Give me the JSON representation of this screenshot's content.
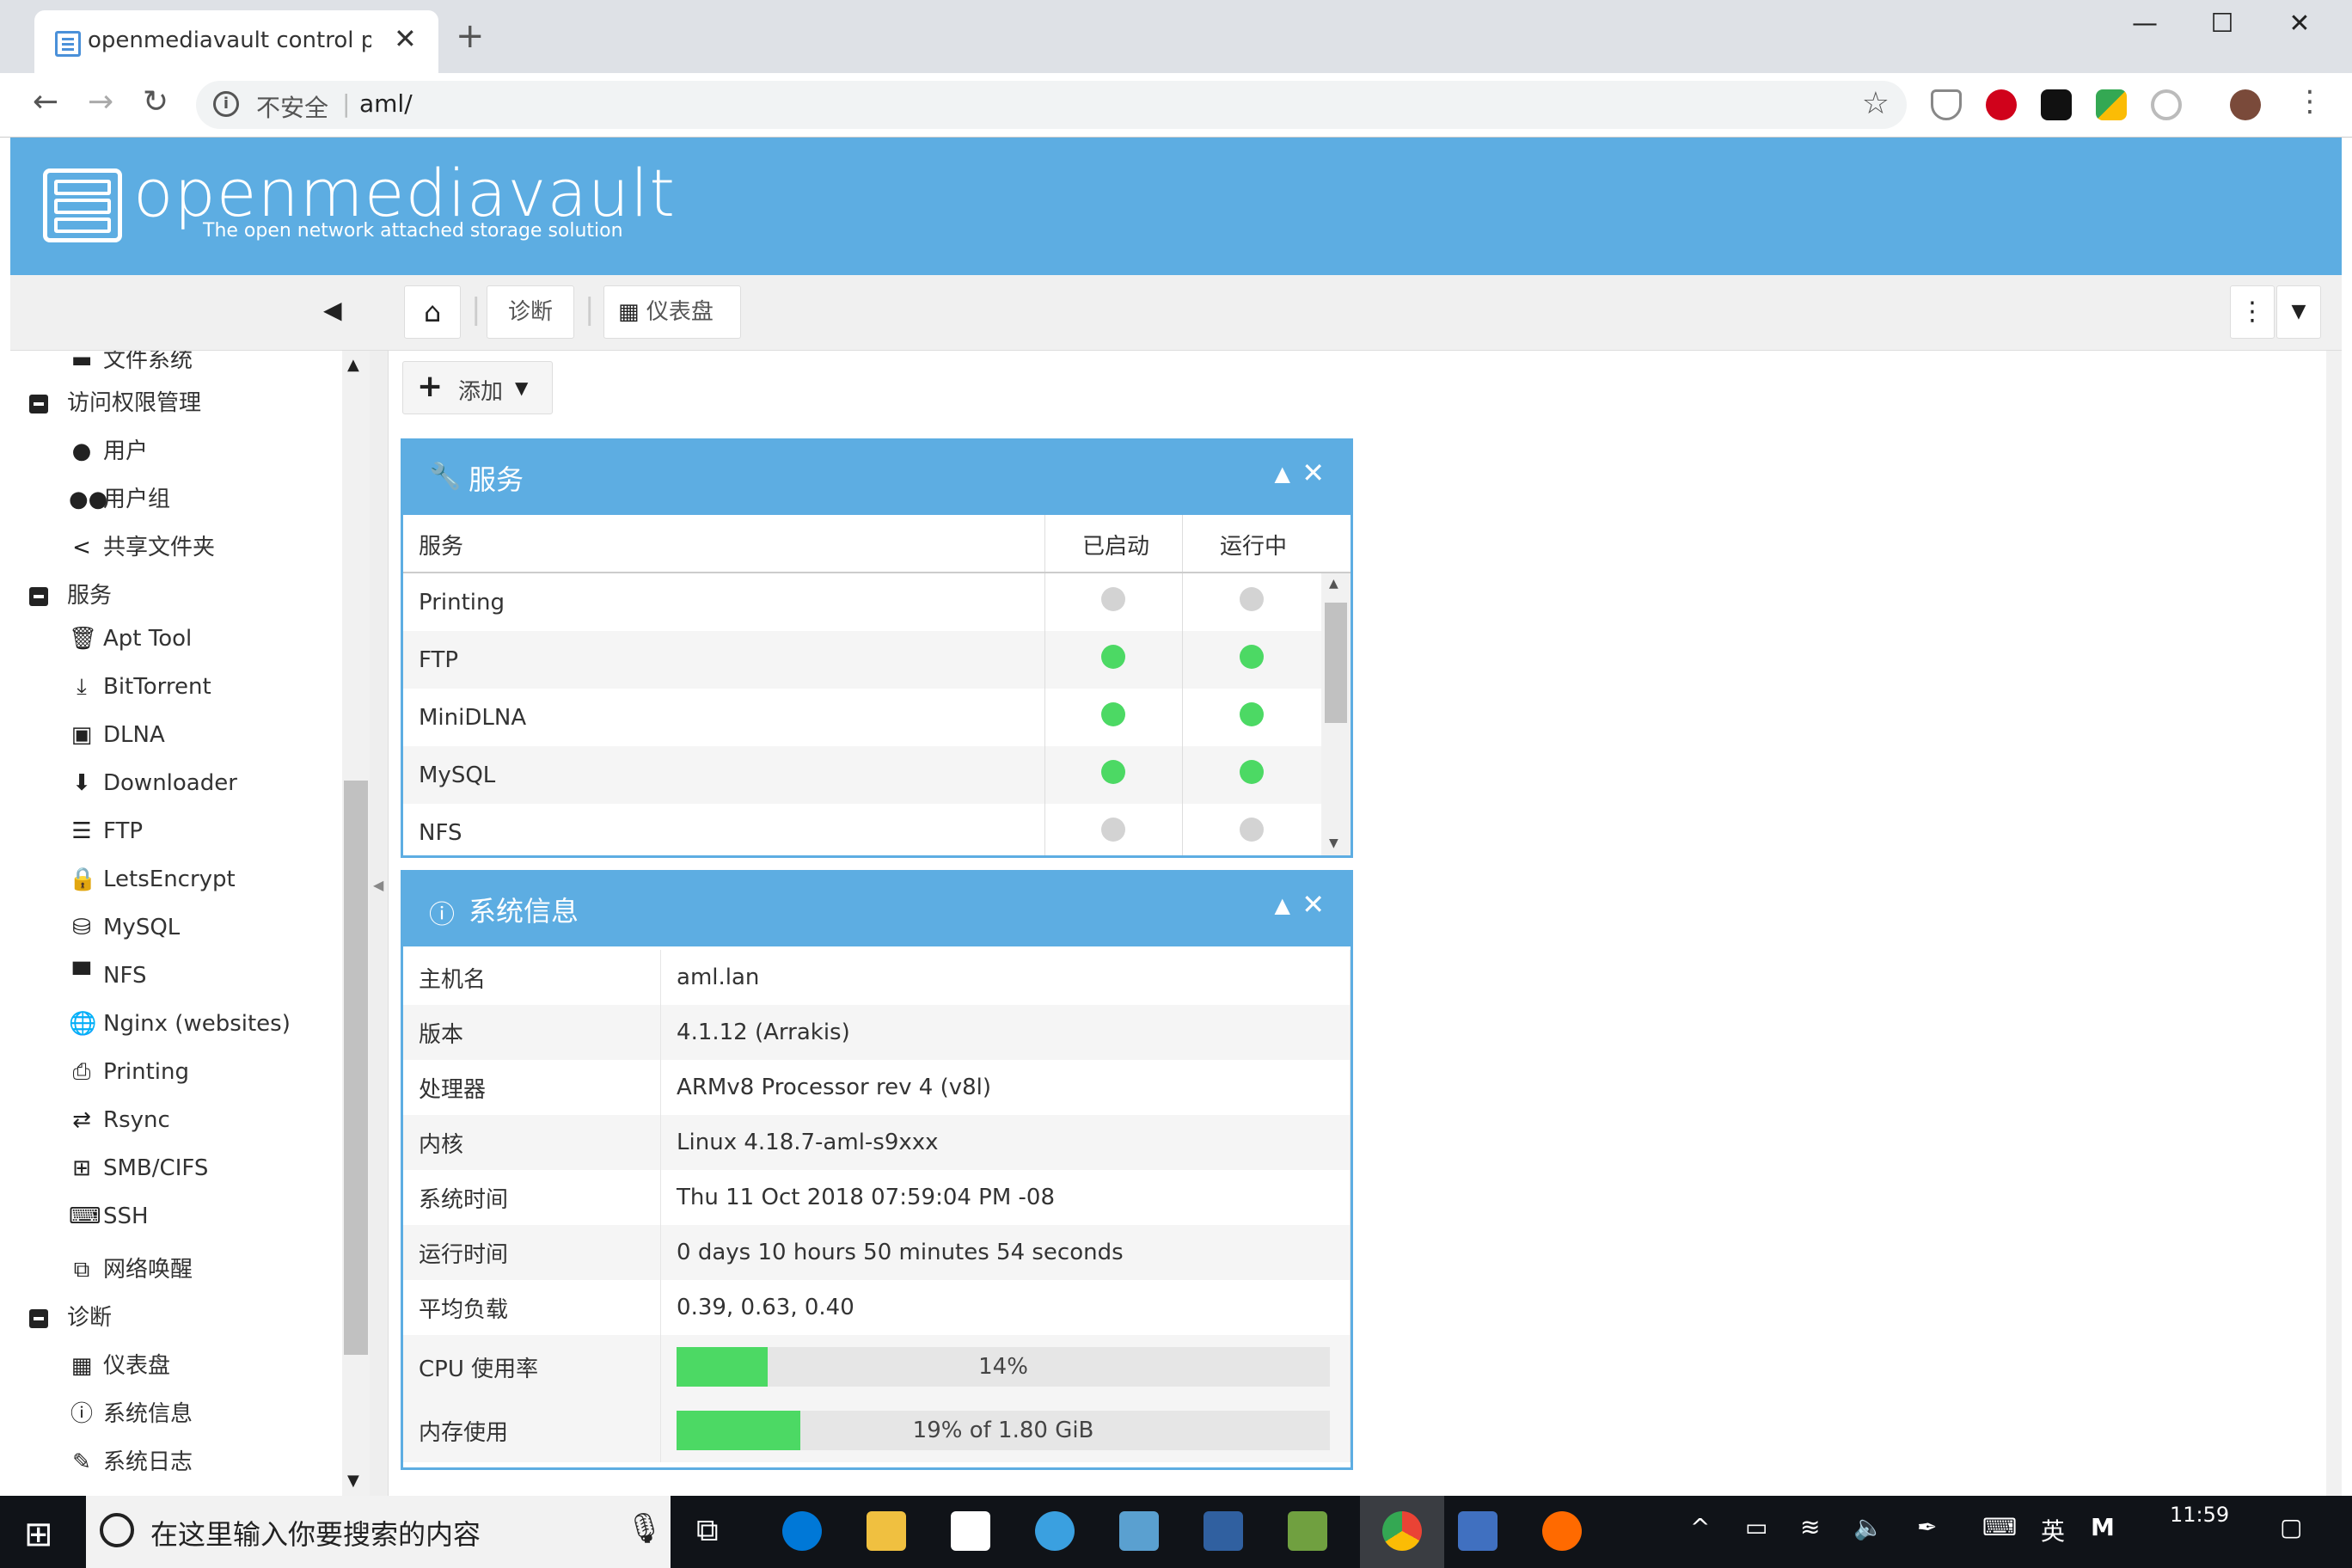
{
  "browser": {
    "tab_title": "openmediavault control panel",
    "tab_close": "✕",
    "new_tab": "+",
    "security_label": "不安全",
    "url": "aml/",
    "window_min": "—",
    "window_max": "☐",
    "window_close": "✕"
  },
  "header": {
    "brand": "openmediavault",
    "tagline": "The open network attached storage solution"
  },
  "breadcrumb": {
    "item1": "诊断",
    "item2": "仪表盘"
  },
  "sidebar": {
    "partial_top": "文件系统",
    "group_access": "访问权限管理",
    "access_items": [
      "用户",
      "用户组",
      "共享文件夹"
    ],
    "group_services": "服务",
    "service_items": [
      "Apt Tool",
      "BitTorrent",
      "DLNA",
      "Downloader",
      "FTP",
      "LetsEncrypt",
      "MySQL",
      "NFS",
      "Nginx (websites)",
      "Printing",
      "Rsync",
      "SMB/CIFS",
      "SSH",
      "网络唤醒"
    ],
    "group_diag": "诊断",
    "diag_items": [
      "仪表盘",
      "系统信息",
      "系统日志"
    ]
  },
  "toolbar": {
    "add_label": "添加"
  },
  "services_panel": {
    "title": "服务",
    "columns": [
      "服务",
      "已启动",
      "运行中"
    ],
    "rows": [
      {
        "name": "Printing",
        "enabled": false,
        "running": false
      },
      {
        "name": "FTP",
        "enabled": true,
        "running": true
      },
      {
        "name": "MiniDLNA",
        "enabled": true,
        "running": true
      },
      {
        "name": "MySQL",
        "enabled": true,
        "running": true
      },
      {
        "name": "NFS",
        "enabled": false,
        "running": false
      }
    ],
    "status_colors": {
      "on": "#4cd964",
      "off": "#d3d3d3"
    }
  },
  "sysinfo_panel": {
    "title": "系统信息",
    "rows": [
      {
        "label": "主机名",
        "value": "aml.lan"
      },
      {
        "label": "版本",
        "value": "4.1.12 (Arrakis)"
      },
      {
        "label": "处理器",
        "value": "ARMv8 Processor rev 4 (v8l)"
      },
      {
        "label": "内核",
        "value": "Linux 4.18.7-aml-s9xxx"
      },
      {
        "label": "系统时间",
        "value": "Thu 11 Oct 2018 07:59:04 PM -08"
      },
      {
        "label": "运行时间",
        "value": "0 days 10 hours 50 minutes 54 seconds"
      },
      {
        "label": "平均负载",
        "value": "0.39, 0.63, 0.40"
      }
    ],
    "cpu": {
      "label": "CPU 使用率",
      "text": "14%",
      "fraction": 0.14
    },
    "memory": {
      "label": "内存使用",
      "text": "19% of 1.80 GiB",
      "fraction": 0.19
    }
  },
  "taskbar": {
    "search_placeholder": "在这里输入你要搜索的内容",
    "ime": "英",
    "time": "11:59"
  },
  "colors": {
    "accent": "#5dade2",
    "ok": "#4cd964"
  }
}
